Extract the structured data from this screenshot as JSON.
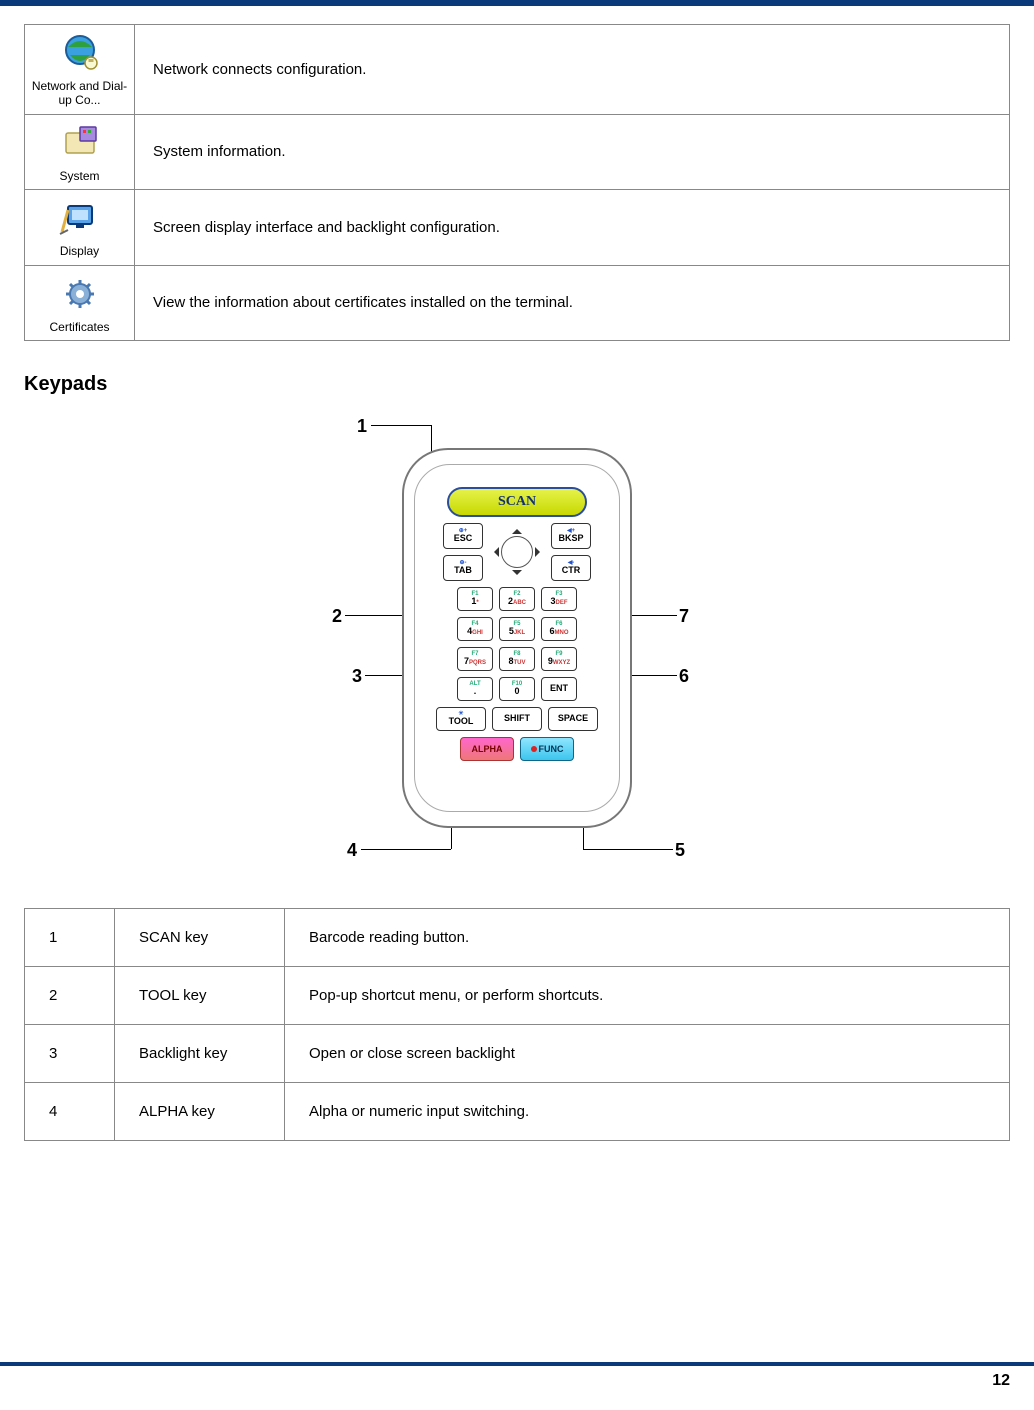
{
  "icon_table": {
    "rows": [
      {
        "icon_label": "Network and Dial-up Co...",
        "desc": "Network connects configuration."
      },
      {
        "icon_label": "System",
        "desc": "System information."
      },
      {
        "icon_label": "Display",
        "desc": "Screen display interface and backlight configuration."
      },
      {
        "icon_label": "Certificates",
        "desc": "View the information about certificates installed on the terminal."
      }
    ]
  },
  "section_heading": "Keypads",
  "keypad": {
    "scan_label": "SCAN",
    "esc": "ESC",
    "bksp": "BKSP",
    "tab": "TAB",
    "ctr": "CTR",
    "tool": "TOOL",
    "shift": "SHIFT",
    "space": "SPACE",
    "alpha": "ALPHA",
    "func": "FUNC",
    "ent": "ENT",
    "numrows": [
      [
        {
          "top": "F1",
          "main": "1",
          "sub": "*"
        },
        {
          "top": "F2",
          "main": "2",
          "sub": "ABC"
        },
        {
          "top": "F3",
          "main": "3",
          "sub": "DEF"
        }
      ],
      [
        {
          "top": "F4",
          "main": "4",
          "sub": "GHI"
        },
        {
          "top": "F5",
          "main": "5",
          "sub": "JKL"
        },
        {
          "top": "F6",
          "main": "6",
          "sub": "MNO"
        }
      ],
      [
        {
          "top": "F7",
          "main": "7",
          "sub": "PQRS"
        },
        {
          "top": "F8",
          "main": "8",
          "sub": "TUV"
        },
        {
          "top": "F9",
          "main": "9",
          "sub": "WXYZ"
        }
      ],
      [
        {
          "top": "ALT",
          "main": ".",
          "sub": ""
        },
        {
          "top": "F10",
          "main": "0",
          "sub": ""
        },
        {
          "top": "",
          "main": "ENT",
          "sub": ""
        }
      ]
    ],
    "callouts": {
      "1": "1",
      "2": "2",
      "3": "3",
      "4": "4",
      "5": "5",
      "6": "6",
      "7": "7"
    }
  },
  "key_table": {
    "rows": [
      {
        "n": "1",
        "name": "SCAN key",
        "desc": "Barcode reading button."
      },
      {
        "n": "2",
        "name": "TOOL key",
        "desc": "Pop-up shortcut menu, or perform shortcuts."
      },
      {
        "n": "3",
        "name": "Backlight key",
        "desc": "Open or close screen backlight"
      },
      {
        "n": "4",
        "name": "ALPHA key",
        "desc": "Alpha or numeric input switching."
      }
    ]
  },
  "page_number": "12"
}
